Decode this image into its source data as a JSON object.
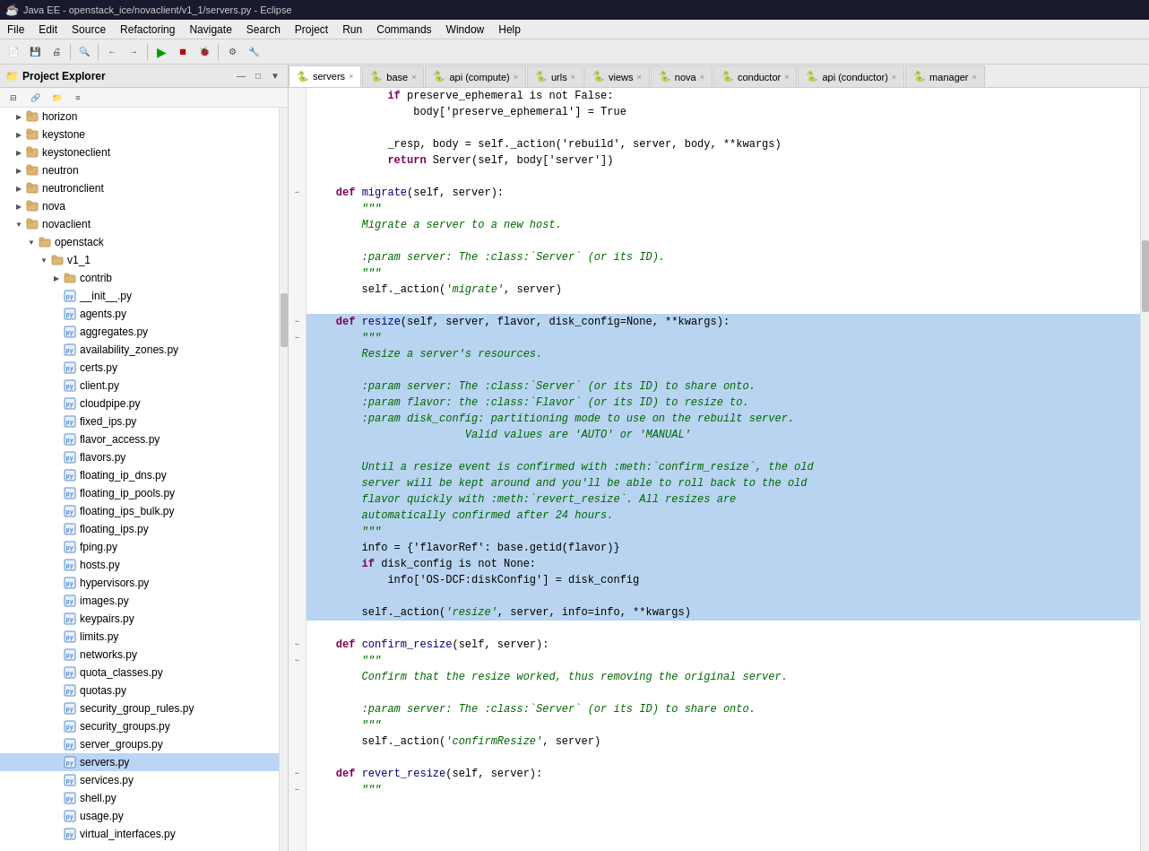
{
  "titleBar": {
    "icon": "☕",
    "title": "Java EE - openstack_ice/novaclient/v1_1/servers.py - Eclipse"
  },
  "menuBar": {
    "items": [
      "File",
      "Edit",
      "Source",
      "Refactoring",
      "Navigate",
      "Search",
      "Project",
      "Run",
      "Commands",
      "Window",
      "Help"
    ]
  },
  "sidebar": {
    "title": "Project Explorer",
    "items": [
      {
        "label": "horizon",
        "type": "project",
        "indent": 1,
        "expanded": false
      },
      {
        "label": "keystone",
        "type": "project",
        "indent": 1,
        "expanded": false
      },
      {
        "label": "keystoneclient",
        "type": "project",
        "indent": 1,
        "expanded": false
      },
      {
        "label": "neutron",
        "type": "project",
        "indent": 1,
        "expanded": false
      },
      {
        "label": "neutronclient",
        "type": "project",
        "indent": 1,
        "expanded": false
      },
      {
        "label": "nova",
        "type": "project",
        "indent": 1,
        "expanded": false
      },
      {
        "label": "novaclient",
        "type": "project",
        "indent": 1,
        "expanded": true
      },
      {
        "label": "openstack",
        "type": "folder",
        "indent": 2,
        "expanded": true
      },
      {
        "label": "v1_1",
        "type": "folder",
        "indent": 3,
        "expanded": true
      },
      {
        "label": "contrib",
        "type": "folder",
        "indent": 4,
        "expanded": false
      },
      {
        "label": "__init__.py",
        "type": "py",
        "indent": 4
      },
      {
        "label": "agents.py",
        "type": "py",
        "indent": 4
      },
      {
        "label": "aggregates.py",
        "type": "py",
        "indent": 4
      },
      {
        "label": "availability_zones.py",
        "type": "py",
        "indent": 4
      },
      {
        "label": "certs.py",
        "type": "py",
        "indent": 4
      },
      {
        "label": "client.py",
        "type": "py",
        "indent": 4
      },
      {
        "label": "cloudpipe.py",
        "type": "py",
        "indent": 4
      },
      {
        "label": "fixed_ips.py",
        "type": "py",
        "indent": 4
      },
      {
        "label": "flavor_access.py",
        "type": "py",
        "indent": 4
      },
      {
        "label": "flavors.py",
        "type": "py",
        "indent": 4
      },
      {
        "label": "floating_ip_dns.py",
        "type": "py",
        "indent": 4
      },
      {
        "label": "floating_ip_pools.py",
        "type": "py",
        "indent": 4
      },
      {
        "label": "floating_ips_bulk.py",
        "type": "py",
        "indent": 4
      },
      {
        "label": "floating_ips.py",
        "type": "py",
        "indent": 4
      },
      {
        "label": "fping.py",
        "type": "py",
        "indent": 4
      },
      {
        "label": "hosts.py",
        "type": "py",
        "indent": 4
      },
      {
        "label": "hypervisors.py",
        "type": "py",
        "indent": 4
      },
      {
        "label": "images.py",
        "type": "py",
        "indent": 4
      },
      {
        "label": "keypairs.py",
        "type": "py",
        "indent": 4
      },
      {
        "label": "limits.py",
        "type": "py",
        "indent": 4
      },
      {
        "label": "networks.py",
        "type": "py",
        "indent": 4
      },
      {
        "label": "quota_classes.py",
        "type": "py",
        "indent": 4
      },
      {
        "label": "quotas.py",
        "type": "py",
        "indent": 4
      },
      {
        "label": "security_group_rules.py",
        "type": "py",
        "indent": 4
      },
      {
        "label": "security_groups.py",
        "type": "py",
        "indent": 4
      },
      {
        "label": "server_groups.py",
        "type": "py",
        "indent": 4
      },
      {
        "label": "servers.py",
        "type": "py",
        "indent": 4,
        "selected": true
      },
      {
        "label": "services.py",
        "type": "py",
        "indent": 4
      },
      {
        "label": "shell.py",
        "type": "py",
        "indent": 4
      },
      {
        "label": "usage.py",
        "type": "py",
        "indent": 4
      },
      {
        "label": "virtual_interfaces.py",
        "type": "py",
        "indent": 4
      }
    ]
  },
  "tabs": [
    {
      "label": "servers",
      "active": true,
      "icon": "🐍",
      "closeable": true
    },
    {
      "label": "base",
      "active": false,
      "icon": "🐍",
      "closeable": true
    },
    {
      "label": "api (compute)",
      "active": false,
      "icon": "🐍",
      "closeable": true
    },
    {
      "label": "urls",
      "active": false,
      "icon": "🐍",
      "closeable": true
    },
    {
      "label": "views",
      "active": false,
      "icon": "🐍",
      "closeable": true
    },
    {
      "label": "nova",
      "active": false,
      "icon": "🐍",
      "closeable": true
    },
    {
      "label": "conductor",
      "active": false,
      "icon": "🐍",
      "closeable": true
    },
    {
      "label": "api (conductor)",
      "active": false,
      "icon": "🐍",
      "closeable": true
    },
    {
      "label": "manager",
      "active": false,
      "icon": "🐍",
      "closeable": true
    }
  ],
  "codeLines": [
    {
      "indent": 12,
      "content": "if preserve_ephemeral is not False:",
      "highlight": false,
      "fold": ""
    },
    {
      "indent": 16,
      "content": "body['preserve_ephemeral'] = True",
      "highlight": false,
      "fold": ""
    },
    {
      "indent": 0,
      "content": "",
      "highlight": false,
      "fold": ""
    },
    {
      "indent": 12,
      "content": "_resp, body = self._action('rebuild', server, body, **kwargs)",
      "highlight": false,
      "fold": ""
    },
    {
      "indent": 12,
      "content": "return Server(self, body['server'])",
      "highlight": false,
      "fold": ""
    },
    {
      "indent": 0,
      "content": "",
      "highlight": false,
      "fold": ""
    },
    {
      "indent": 4,
      "content": "def migrate(self, server):",
      "highlight": false,
      "fold": "collapse"
    },
    {
      "indent": 8,
      "content": "\"\"\"",
      "highlight": false,
      "fold": ""
    },
    {
      "indent": 8,
      "content": "Migrate a server to a new host.",
      "highlight": false,
      "fold": ""
    },
    {
      "indent": 0,
      "content": "",
      "highlight": false,
      "fold": ""
    },
    {
      "indent": 8,
      "content": ":param server: The :class:`Server` (or its ID).",
      "highlight": false,
      "fold": ""
    },
    {
      "indent": 8,
      "content": "\"\"\"",
      "highlight": false,
      "fold": ""
    },
    {
      "indent": 8,
      "content": "self._action('migrate', server)",
      "highlight": false,
      "fold": ""
    },
    {
      "indent": 0,
      "content": "",
      "highlight": false,
      "fold": ""
    },
    {
      "indent": 4,
      "content": "def resize(self, server, flavor, disk_config=None, **kwargs):",
      "highlight": true,
      "fold": "collapse"
    },
    {
      "indent": 8,
      "content": "\"\"\"",
      "highlight": true,
      "fold": "collapse"
    },
    {
      "indent": 8,
      "content": "Resize a server's resources.",
      "highlight": true,
      "fold": ""
    },
    {
      "indent": 0,
      "content": "",
      "highlight": true,
      "fold": ""
    },
    {
      "indent": 8,
      "content": ":param server: The :class:`Server` (or its ID) to share onto.",
      "highlight": true,
      "fold": ""
    },
    {
      "indent": 8,
      "content": ":param flavor: the :class:`Flavor` (or its ID) to resize to.",
      "highlight": true,
      "fold": ""
    },
    {
      "indent": 8,
      "content": ":param disk_config: partitioning mode to use on the rebuilt server.",
      "highlight": true,
      "fold": ""
    },
    {
      "indent": 24,
      "content": "Valid values are 'AUTO' or 'MANUAL'",
      "highlight": true,
      "fold": ""
    },
    {
      "indent": 0,
      "content": "",
      "highlight": true,
      "fold": ""
    },
    {
      "indent": 8,
      "content": "Until a resize event is confirmed with :meth:`confirm_resize`, the old",
      "highlight": true,
      "fold": ""
    },
    {
      "indent": 8,
      "content": "server will be kept around and you'll be able to roll back to the old",
      "highlight": true,
      "fold": ""
    },
    {
      "indent": 8,
      "content": "flavor quickly with :meth:`revert_resize`. All resizes are",
      "highlight": true,
      "fold": ""
    },
    {
      "indent": 8,
      "content": "automatically confirmed after 24 hours.",
      "highlight": true,
      "fold": ""
    },
    {
      "indent": 8,
      "content": "\"\"\"",
      "highlight": true,
      "fold": ""
    },
    {
      "indent": 8,
      "content": "info = {'flavorRef': base.getid(flavor)}",
      "highlight": true,
      "fold": ""
    },
    {
      "indent": 8,
      "content": "if disk_config is not None:",
      "highlight": true,
      "fold": ""
    },
    {
      "indent": 12,
      "content": "info['OS-DCF:diskConfig'] = disk_config",
      "highlight": true,
      "fold": ""
    },
    {
      "indent": 0,
      "content": "",
      "highlight": true,
      "fold": ""
    },
    {
      "indent": 8,
      "content": "self._action('resize', server, info=info, **kwargs)",
      "highlight": true,
      "fold": ""
    },
    {
      "indent": 0,
      "content": "",
      "highlight": false,
      "fold": ""
    },
    {
      "indent": 4,
      "content": "def confirm_resize(self, server):",
      "highlight": false,
      "fold": "collapse"
    },
    {
      "indent": 8,
      "content": "\"\"\"",
      "highlight": false,
      "fold": "collapse"
    },
    {
      "indent": 8,
      "content": "Confirm that the resize worked, thus removing the original server.",
      "highlight": false,
      "fold": ""
    },
    {
      "indent": 0,
      "content": "",
      "highlight": false,
      "fold": ""
    },
    {
      "indent": 8,
      "content": ":param server: The :class:`Server` (or its ID) to share onto.",
      "highlight": false,
      "fold": ""
    },
    {
      "indent": 8,
      "content": "\"\"\"",
      "highlight": false,
      "fold": ""
    },
    {
      "indent": 8,
      "content": "self._action('confirmResize', server)",
      "highlight": false,
      "fold": ""
    },
    {
      "indent": 0,
      "content": "",
      "highlight": false,
      "fold": ""
    },
    {
      "indent": 4,
      "content": "def revert_resize(self, server):",
      "highlight": false,
      "fold": "collapse"
    },
    {
      "indent": 8,
      "content": "\"\"\"",
      "highlight": false,
      "fold": "collapse"
    }
  ]
}
